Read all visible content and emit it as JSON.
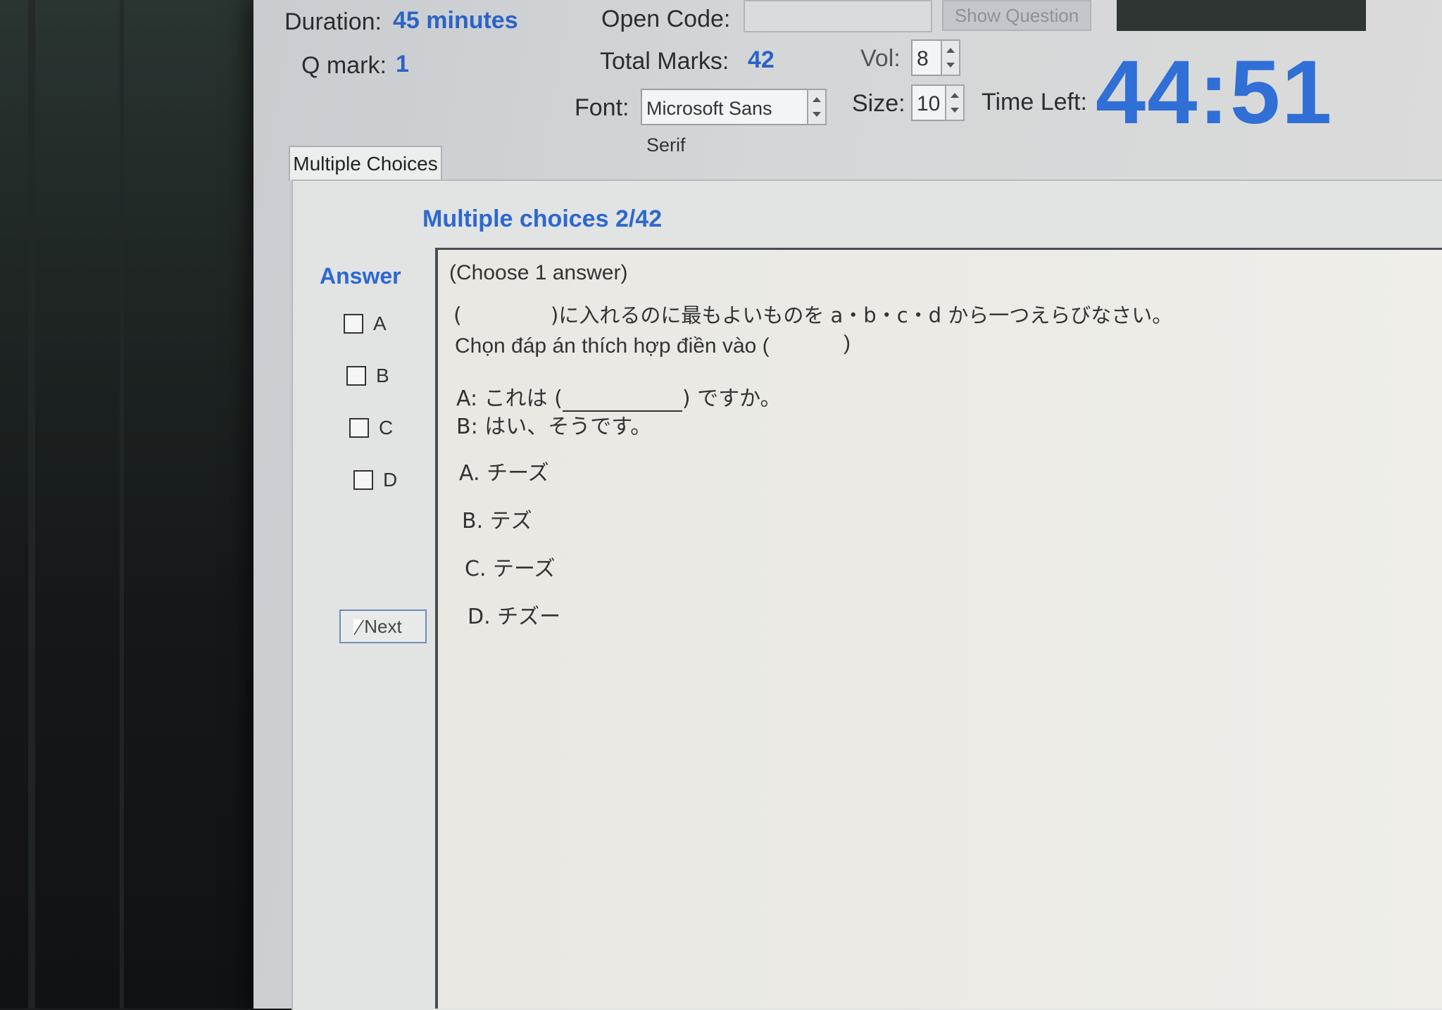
{
  "header": {
    "duration_label": "Duration:",
    "duration_value": "45 minutes",
    "qmark_label": "Q mark:",
    "qmark_value": "1",
    "open_code_label": "Open Code:",
    "open_code_value": "",
    "show_question_label": "Show Question",
    "total_marks_label": "Total Marks:",
    "total_marks_value": "42",
    "vol_label": "Vol:",
    "vol_value": "8",
    "font_label": "Font:",
    "font_value": "Microsoft Sans Serif",
    "size_label": "Size:",
    "size_value": "10",
    "time_left_label": "Time Left:",
    "time_left_value": "44:51"
  },
  "tab": {
    "label": "Multiple Choices"
  },
  "main": {
    "title": "Multiple choices 2/42",
    "answer_label": "Answer",
    "options": [
      {
        "label": "A"
      },
      {
        "label": "B"
      },
      {
        "label": "C"
      },
      {
        "label": "D"
      }
    ],
    "next_label": "Next"
  },
  "question": {
    "instruction": "(Choose 1 answer)",
    "jp_prompt_open": "(",
    "jp_prompt_rest": ")に入れるのに最もよいものを a・b・c・d から一つえらびなさい。",
    "vn_prompt": "Chọn đáp án thích hợp điền vào (",
    "vn_prompt_close": ")",
    "line_a_prefix": "A:  これは (",
    "line_a_suffix": ") ですか。",
    "line_b": "B:  はい、そうです。",
    "choices": [
      "A.  チーズ",
      "B.  テズ",
      "C.  テーズ",
      "D.  チズー"
    ]
  },
  "colors": {
    "accent_blue": "#2c63c6",
    "timer_blue": "#2f6fd6"
  }
}
